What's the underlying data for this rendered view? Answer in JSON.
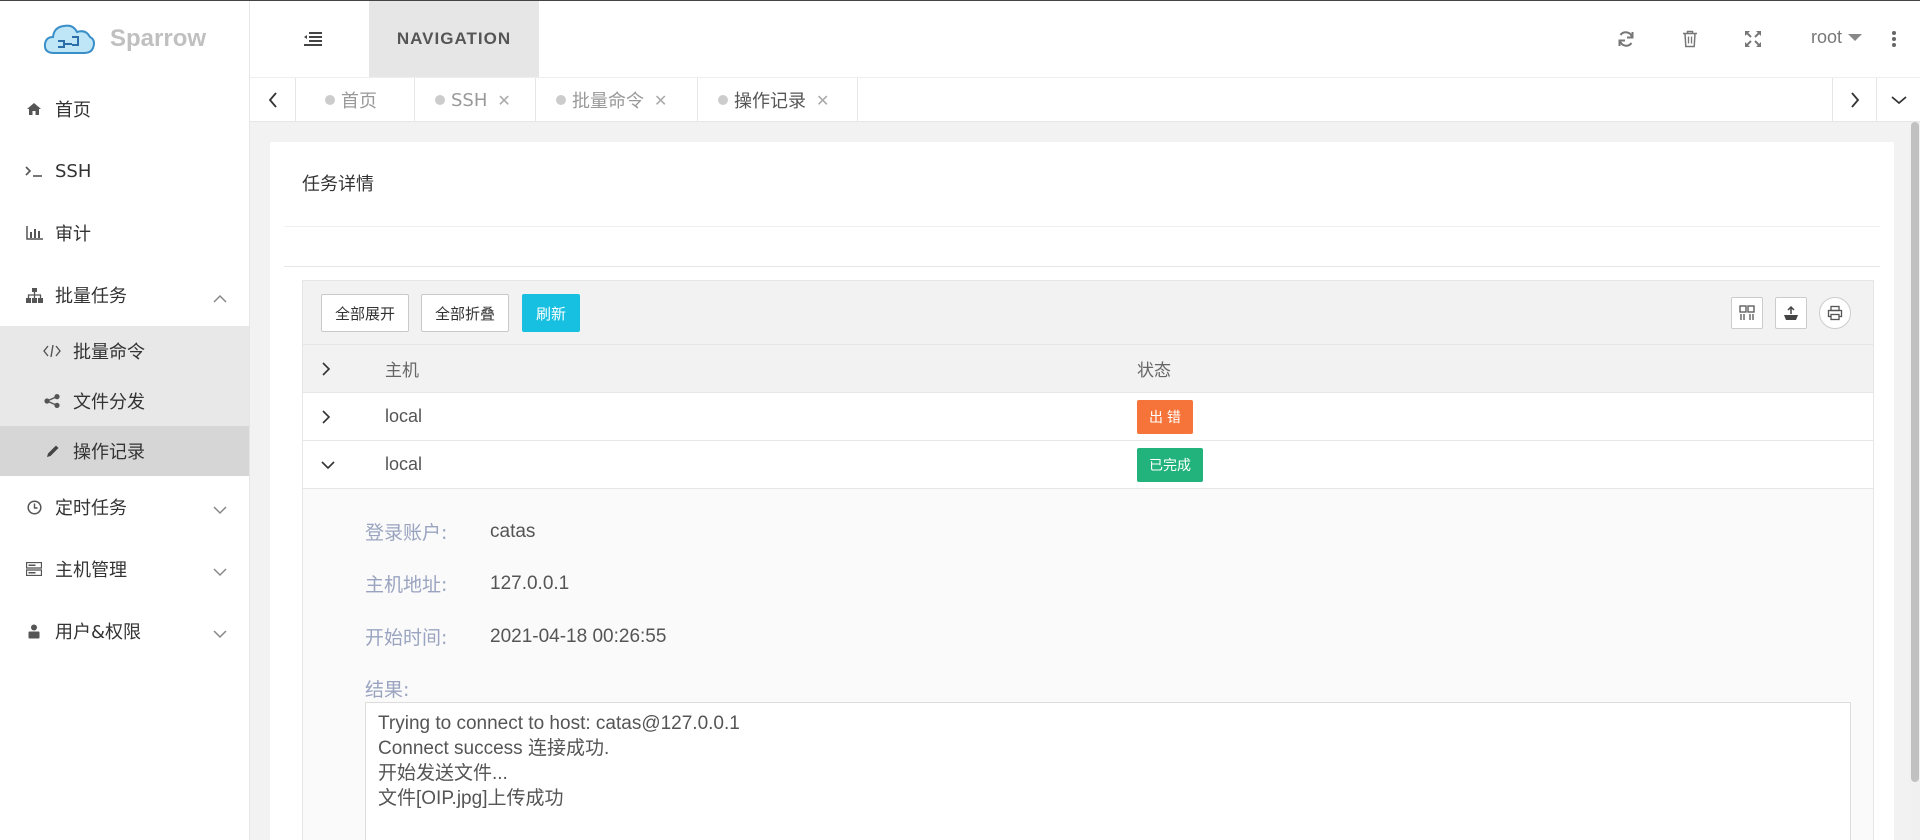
{
  "app": {
    "name": "Sparrow"
  },
  "sidebar": {
    "items": [
      {
        "label": "首页",
        "icon": "home-icon"
      },
      {
        "label": "SSH",
        "icon": "terminal-icon"
      },
      {
        "label": "审计",
        "icon": "bar-chart-icon"
      },
      {
        "label": "批量任务",
        "icon": "sitemap-icon",
        "expanded": true,
        "children": [
          {
            "label": "批量命令",
            "icon": "code-icon"
          },
          {
            "label": "文件分发",
            "icon": "share-icon"
          },
          {
            "label": "操作记录",
            "icon": "pencil-icon",
            "active": true
          }
        ]
      },
      {
        "label": "定时任务",
        "icon": "clock-icon"
      },
      {
        "label": "主机管理",
        "icon": "server-icon"
      },
      {
        "label": "用户&权限",
        "icon": "user-lock-icon"
      }
    ]
  },
  "header": {
    "nav_label": "NAVIGATION",
    "user": "root"
  },
  "tabs": [
    {
      "label": "首页",
      "closable": false
    },
    {
      "label": "SSH",
      "closable": true
    },
    {
      "label": "批量命令",
      "closable": true
    },
    {
      "label": "操作记录",
      "closable": true,
      "current": true
    }
  ],
  "card": {
    "title": "任务详情"
  },
  "toolbar": {
    "expand_all": "全部展开",
    "collapse_all": "全部折叠",
    "refresh": "刷新"
  },
  "table": {
    "columns": [
      "主机",
      "状态"
    ],
    "rows": [
      {
        "host": "local",
        "status": "出 错",
        "status_color": "#f6743a",
        "expanded": false
      },
      {
        "host": "local",
        "status": "已完成",
        "status_color": "#21b37b",
        "expanded": true
      }
    ]
  },
  "detail": {
    "account_label": "登录账户:",
    "account": "catas",
    "address_label": "主机地址:",
    "address": "127.0.0.1",
    "start_label": "开始时间:",
    "start": "2021-04-18 00:26:55",
    "result_label": "结果:",
    "result_lines": [
      "Trying to connect to host: catas@127.0.0.1",
      "Connect success 连接成功.",
      "开始发送文件...",
      "文件[OIP.jpg]上传成功"
    ]
  }
}
